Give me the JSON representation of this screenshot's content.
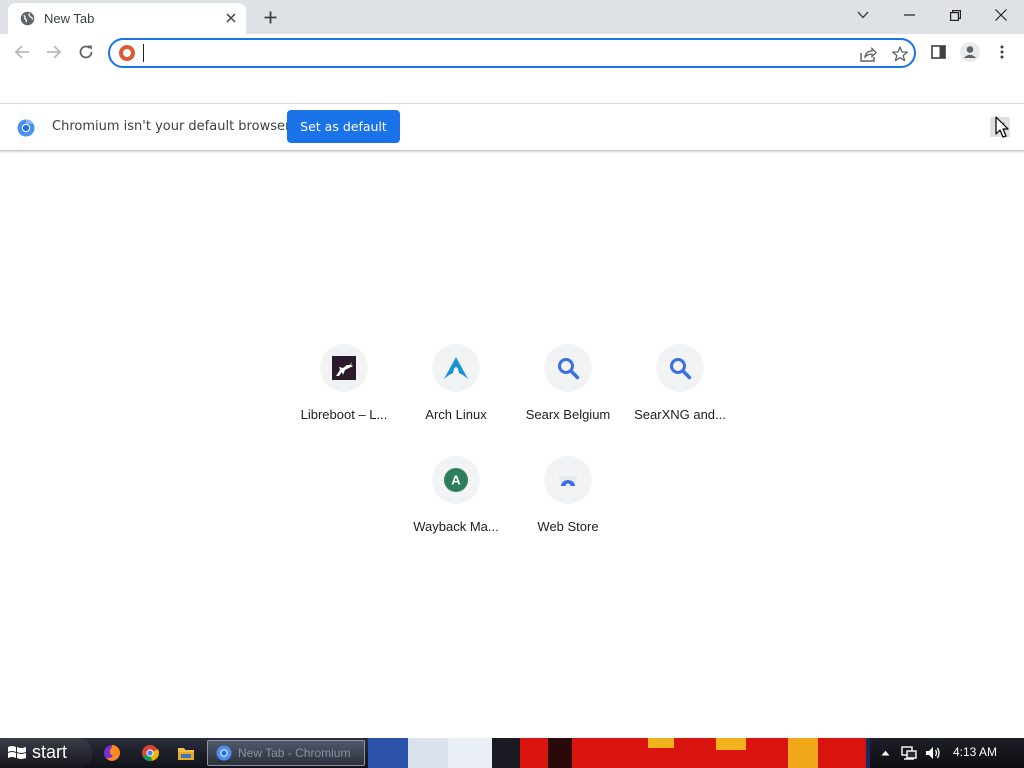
{
  "browser": {
    "tab": {
      "title": "New Tab"
    },
    "infobar": {
      "message": "Chromium isn't your default browser",
      "button_label": "Set as default"
    },
    "omnibox": {
      "value": "",
      "placeholder": ""
    }
  },
  "shortcuts": [
    {
      "label": "Libreboot – L...",
      "icon": "libreboot-deer-icon"
    },
    {
      "label": "Arch Linux",
      "icon": "arch-linux-icon"
    },
    {
      "label": "Searx Belgium",
      "icon": "search-icon"
    },
    {
      "label": "SearXNG and...",
      "icon": "search-icon"
    },
    {
      "label": "Wayback Ma...",
      "icon": "letter-a-icon",
      "letter": "A"
    },
    {
      "label": "Web Store",
      "icon": "web-store-icon"
    }
  ],
  "taskbar": {
    "start_label": "start",
    "task_label": "New Tab - Chromium",
    "clock": "4:13 AM"
  },
  "colors": {
    "accent": "#1a73e8",
    "tabstrip": "#dee1e6",
    "wayback_green": "#2e7d5b",
    "searx_blue": "#3b6fe0"
  }
}
